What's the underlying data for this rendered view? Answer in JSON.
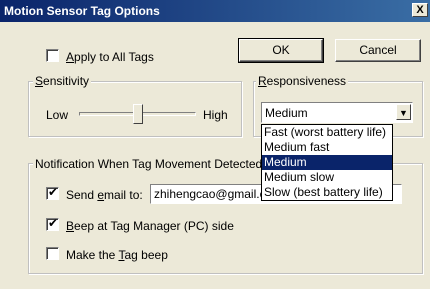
{
  "title": "Motion Sensor Tag Options",
  "close_glyph": "X",
  "apply_all": {
    "prefix": "",
    "accel": "A",
    "suffix": "pply to All Tags",
    "checked": false
  },
  "ok_label": "OK",
  "cancel_label": "Cancel",
  "sensitivity": {
    "title_accel": "S",
    "title_rest": "ensitivity",
    "low_label": "Low",
    "high_label": "High",
    "level": 0.5
  },
  "responsiveness": {
    "title_accel": "R",
    "title_rest": "esponsiveness",
    "selected": "Medium",
    "options": [
      {
        "label": "Fast (worst battery life)",
        "selected": false
      },
      {
        "label": "Medium fast",
        "selected": false
      },
      {
        "label": "Medium",
        "selected": true
      },
      {
        "label": "Medium slow",
        "selected": false
      },
      {
        "label": "Slow (best battery life)",
        "selected": false
      }
    ]
  },
  "notification": {
    "title": "Notification When Tag Movement Detected",
    "send_email": {
      "prefix": "Send ",
      "accel": "e",
      "suffix": "mail to:",
      "checked": true,
      "value": "zhihengcao@gmail.com"
    },
    "beep_manager": {
      "prefix": "",
      "accel": "B",
      "suffix": "eep at Tag Manager (PC) side",
      "checked": true
    },
    "tag_beep": {
      "prefix": "Make the ",
      "accel": "T",
      "suffix": "ag beep",
      "checked": false
    }
  },
  "check_glyph": "✔"
}
